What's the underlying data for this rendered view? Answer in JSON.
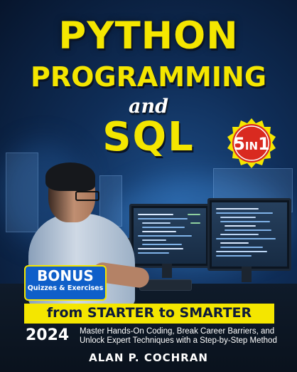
{
  "cover": {
    "title_line1": "PYTHON",
    "title_line2": "PROGRAMMING",
    "title_and": "and",
    "title_line3": "SQL",
    "badge": {
      "number": "5",
      "label": "IN",
      "suffix": "1"
    },
    "bonus": {
      "title": "BONUS",
      "subtitle": "Quizzes & Exercises"
    },
    "tagline": "from STARTER to SMARTER",
    "year": "2024",
    "subtitle_line1": "Master Hands-On Coding, Break Career Barriers, and",
    "subtitle_line2": "Unlock Expert Techniques with a Step-by-Step Method",
    "author": "ALAN P. COCHRAN"
  },
  "colors": {
    "title_yellow": "#f4e600",
    "background_navy": "#0f2d57",
    "badge_red": "#d92a20",
    "bonus_blue": "#0f5fc9",
    "strip_text": "#0d1a3a"
  }
}
